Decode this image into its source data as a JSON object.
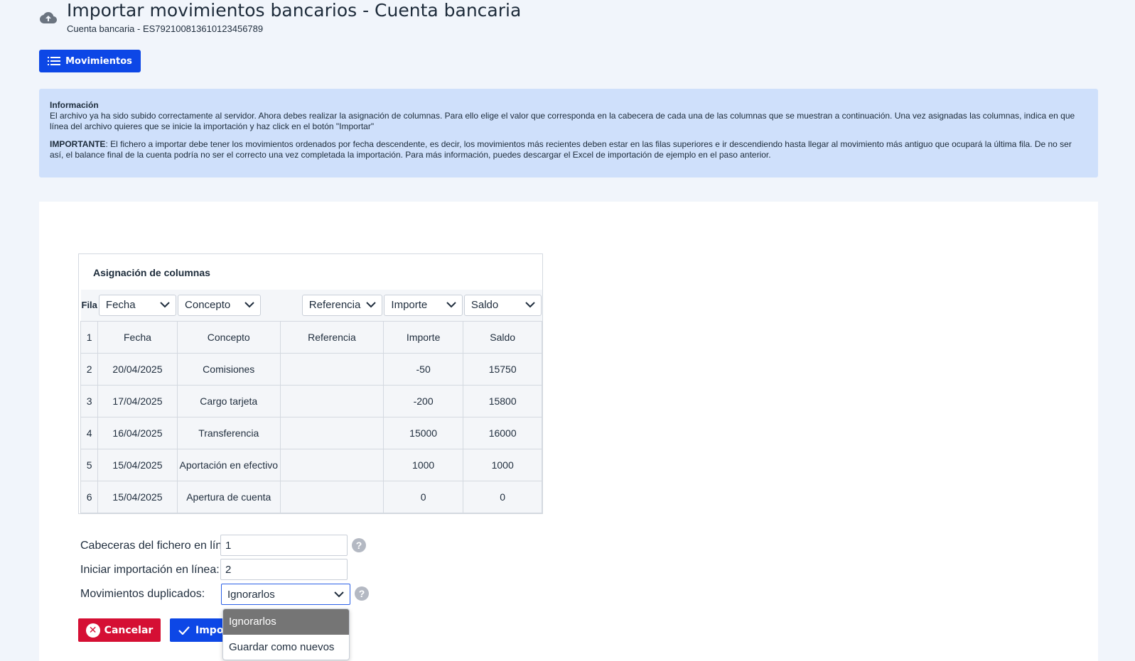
{
  "header": {
    "title": "Importar movimientos bancarios - Cuenta bancaria",
    "subtitle": "Cuenta bancaria - ES7921008136101234567​89"
  },
  "toolbar": {
    "movements_label": "Movimientos"
  },
  "info": {
    "title": "Información",
    "text1": "El archivo ya ha sido subido correctamente al servidor. Ahora debes realizar la asignación de columnas. Para ello elige el valor que corresponda en la cabecera de cada una de las columnas que se muestran a continuación. Una vez asignadas las columnas, indica en que línea del archivo quieres que se inicie la importación y haz click en el botón \"Importar\"",
    "important_label": "IMPORTANTE",
    "text2": ": El fichero a importar debe tener los movimientos ordenados por fecha descendente, es decir, los movimientos más recientes deben estar en las filas superiores e ir descendiendo hasta llegar al movimiento más antiguo que ocupará la última fila. De no ser así, el balance final de la cuenta podría no ser el correcto una vez completada la importación. Para más información, puedes descargar el Excel de importación de ejemplo en el paso anterior."
  },
  "mapping": {
    "title": "Asignación de columnas",
    "row_header": "Fila",
    "selects": [
      "Fecha",
      "Concepto",
      "",
      "Referencia",
      "Importe",
      "Saldo"
    ],
    "rows": [
      [
        "1",
        "Fecha",
        "Concepto",
        "Referencia",
        "Importe",
        "Saldo"
      ],
      [
        "2",
        "20/04/2025",
        "Comisiones",
        "",
        "-50",
        "15750"
      ],
      [
        "3",
        "17/04/2025",
        "Cargo tarjeta",
        "",
        "-200",
        "15800"
      ],
      [
        "4",
        "16/04/2025",
        "Transferencia",
        "",
        "15000",
        "16000"
      ],
      [
        "5",
        "15/04/2025",
        "Aportación en efectivo",
        "",
        "1000",
        "1000"
      ],
      [
        "6",
        "15/04/2025",
        "Apertura de cuenta",
        "",
        "0",
        "0"
      ]
    ]
  },
  "form": {
    "header_line_label": "Cabeceras del fichero en línea:",
    "header_line_value": "1",
    "start_line_label": "Iniciar importación en línea:",
    "start_line_value": "2",
    "duplicates_label": "Movimientos duplicados:",
    "duplicates_value": "Ignorarlos",
    "duplicates_options": [
      "Ignorarlos",
      "Guardar como nuevos"
    ]
  },
  "actions": {
    "cancel_label": "Cancelar",
    "import_label": "Importar"
  },
  "colors": {
    "primary": "#0d47e6",
    "danger": "#d50f34",
    "info_bg": "#cfe0fb"
  }
}
